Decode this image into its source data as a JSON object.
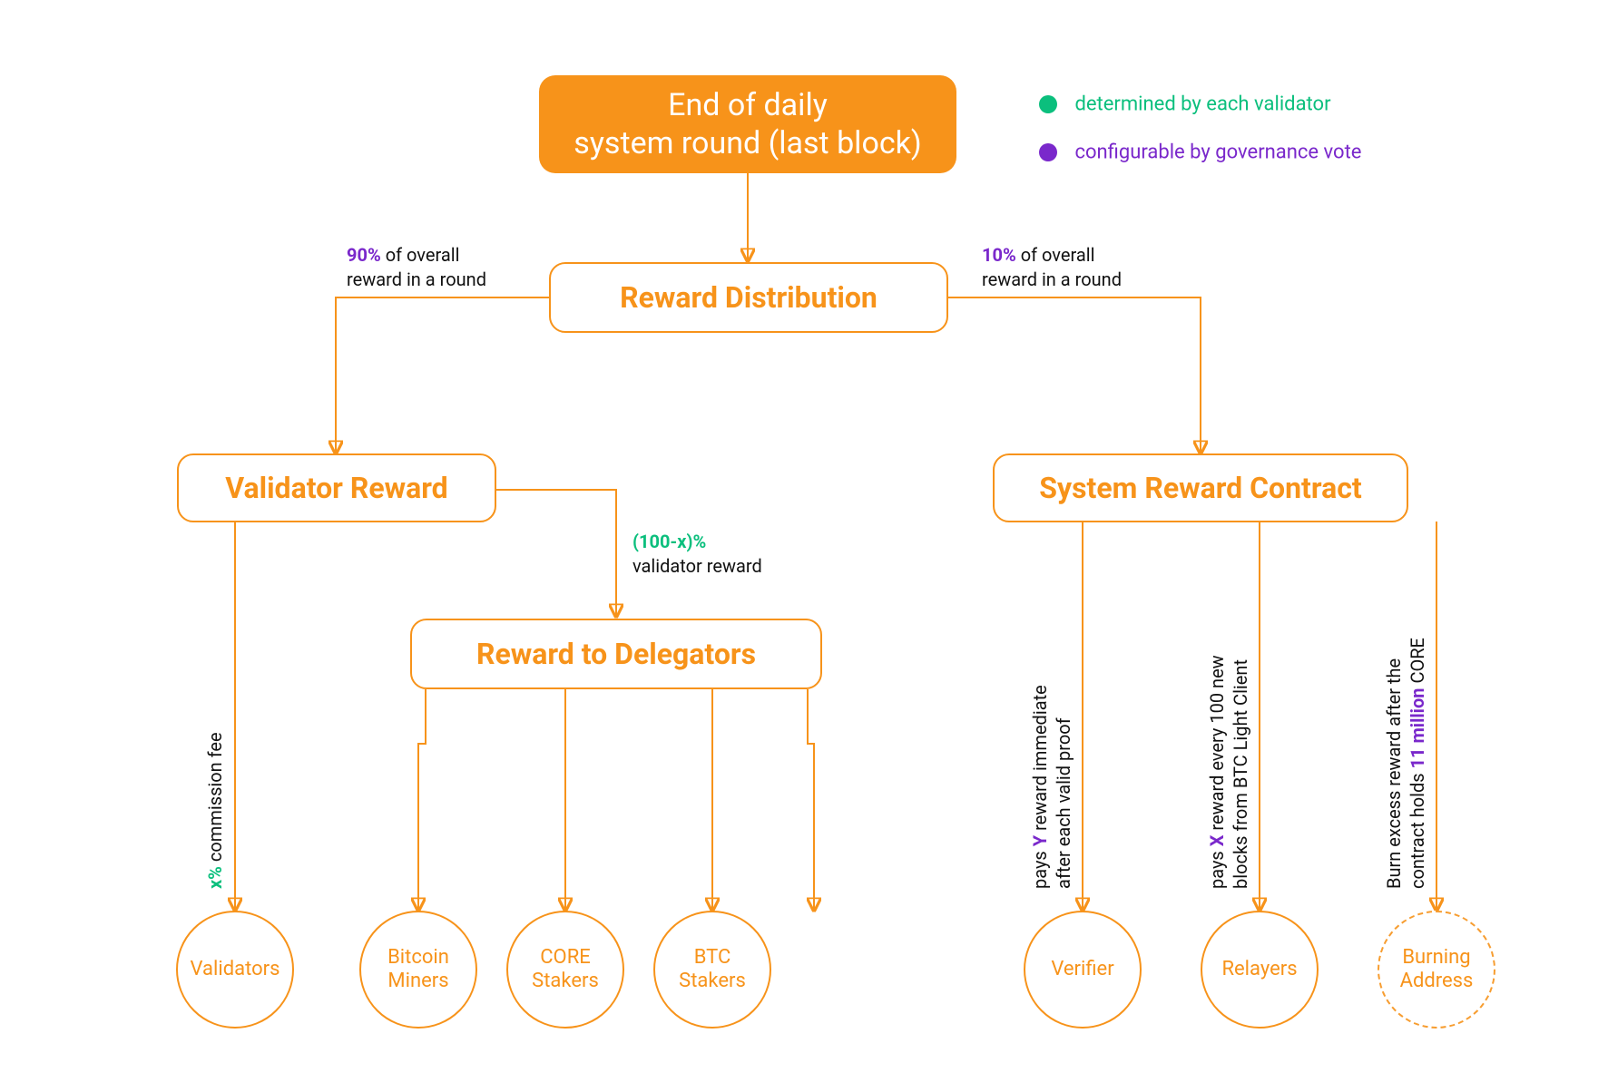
{
  "nodes": {
    "root": "End of daily\nsystem round (last block)",
    "reward_distribution": "Reward Distribution",
    "validator_reward": "Validator Reward",
    "reward_to_delegators": "Reward to Delegators",
    "system_reward_contract": "System Reward Contract",
    "validators": "Validators",
    "bitcoin_miners": "Bitcoin\nMiners",
    "core_stakers": "CORE\nStakers",
    "btc_stakers": "BTC\nStakers",
    "verifier": "Verifier",
    "relayers": "Relayers",
    "burning_address": "Burning\nAddress"
  },
  "labels": {
    "pct90_strong": "90%",
    "pct90_tail": " of overall",
    "pct90_line2": "reward in a round",
    "pct10_strong": "10%",
    "pct10_tail": " of overall",
    "pct10_line2": "reward in a round",
    "delegator_split_strong": "(100-x)%",
    "delegator_split_line2": "validator reward",
    "commission_strong": "x%",
    "commission_tail": " commission fee",
    "verifier_pre": "pays ",
    "verifier_strong": "Y",
    "verifier_tail": " reward immediate",
    "verifier_line2": "after each valid proof",
    "relayers_pre": "pays ",
    "relayers_strong": "X",
    "relayers_tail": " reward every 100 new",
    "relayers_line2": "blocks from BTC Light Client",
    "burning_line1": "Burn excess reward after the",
    "burning_pre2": "contract holds ",
    "burning_strong": "11 million",
    "burning_tail2": " CORE"
  },
  "legend": {
    "green": "determined by each validator",
    "purple": "configurable by governance vote"
  },
  "colors": {
    "orange": "#F7931A",
    "green": "#0bbf7d",
    "purple": "#7A28CB"
  }
}
